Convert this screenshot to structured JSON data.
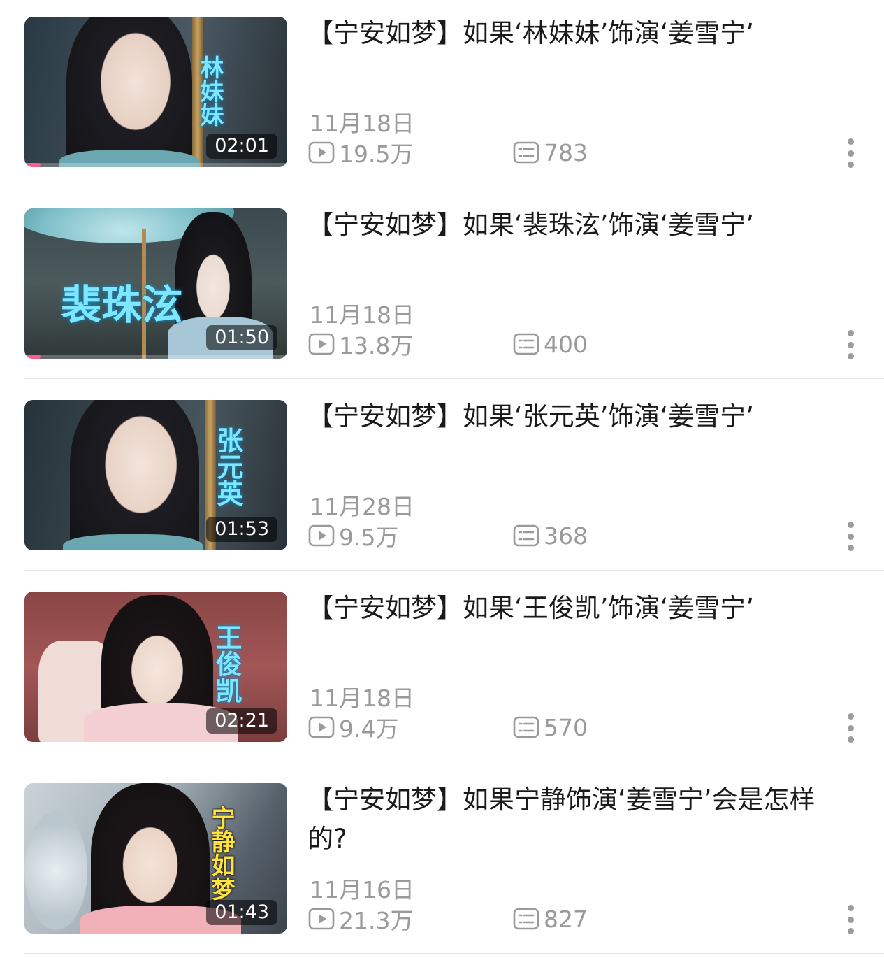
{
  "videos": [
    {
      "title": "【宁安如梦】如果‘林妹妹’饰演‘姜雪宁’",
      "date": "11月18日",
      "views": "19.5万",
      "comments": "783",
      "duration": "02:01",
      "overlay_text": "林妹妹",
      "progress": 0.06
    },
    {
      "title": "【宁安如梦】如果‘裴珠泫’饰演‘姜雪宁’",
      "date": "11月18日",
      "views": "13.8万",
      "comments": "400",
      "duration": "01:50",
      "overlay_text": "裴珠泫",
      "progress": 0.06
    },
    {
      "title": "【宁安如梦】如果‘张元英’饰演‘姜雪宁’",
      "date": "11月28日",
      "views": "9.5万",
      "comments": "368",
      "duration": "01:53",
      "overlay_text": "张元英",
      "progress": 0
    },
    {
      "title": "【宁安如梦】如果‘王俊凯’饰演‘姜雪宁’",
      "date": "11月18日",
      "views": "9.4万",
      "comments": "570",
      "duration": "02:21",
      "overlay_text": "王俊凯",
      "progress": 0
    },
    {
      "title": "【宁安如梦】如果宁静饰演‘姜雪宁’会是怎样的?",
      "date": "11月16日",
      "views": "21.3万",
      "comments": "827",
      "duration": "01:43",
      "overlay_text": "宁静如梦",
      "progress": 0
    }
  ],
  "icons": {
    "play": "play-count-icon",
    "comments": "danmaku-comment-icon",
    "more": "more-vertical-icon"
  },
  "colors": {
    "title": "#1a1a1a",
    "meta": "#9a9a9a",
    "progress": "#ff5c8a",
    "overlay_cyan": "#7fe6ff",
    "overlay_yellow": "#ffe23a"
  }
}
